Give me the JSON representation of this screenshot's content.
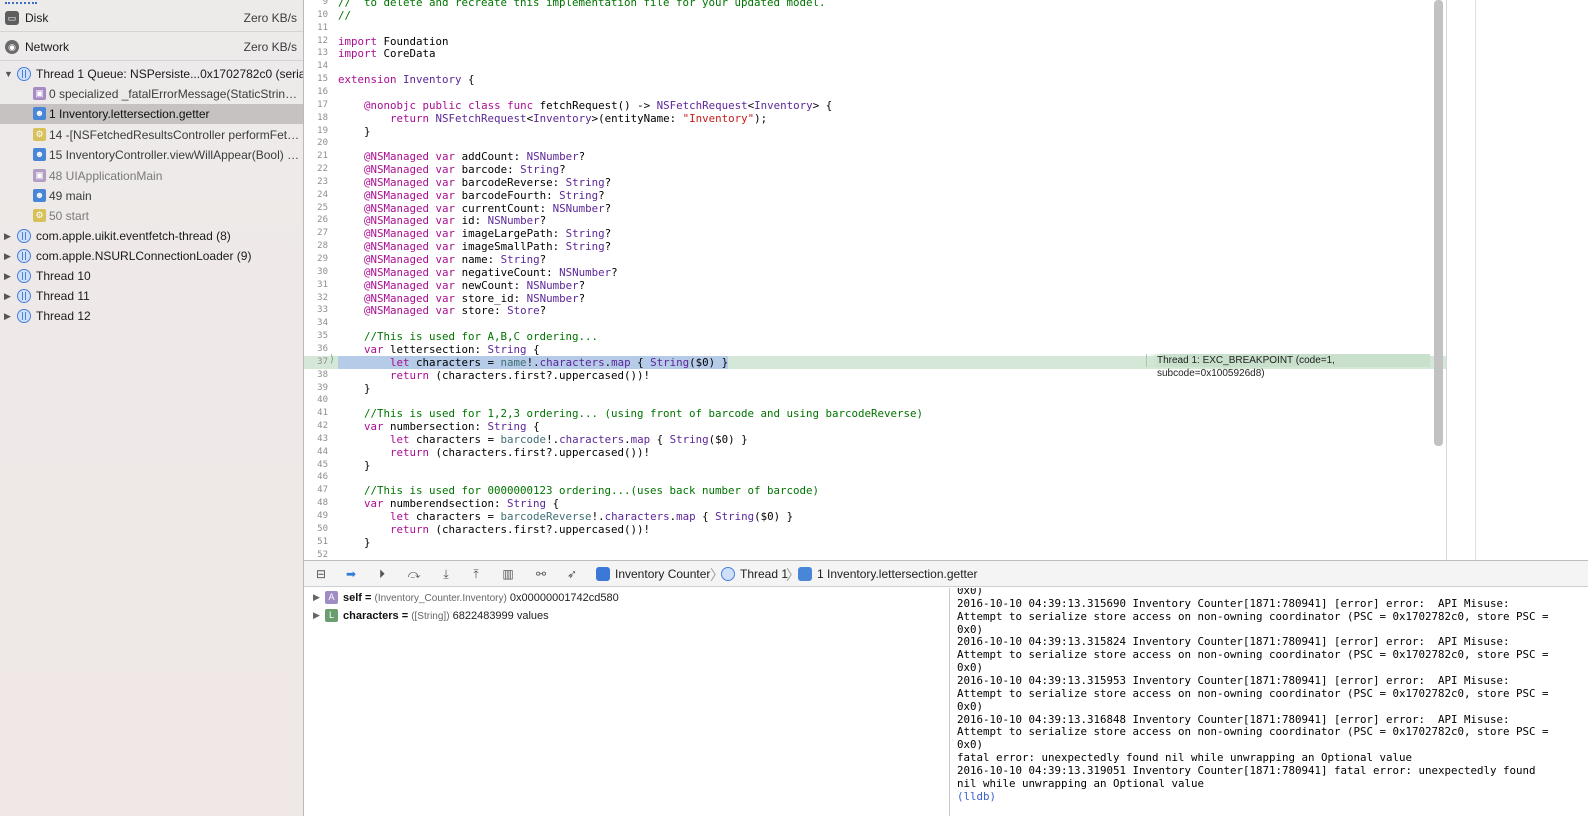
{
  "navigator": {
    "gauges": [
      {
        "label": "Disk",
        "value": "Zero KB/s",
        "icon": "disk-icon"
      },
      {
        "label": "Network",
        "value": "Zero KB/s",
        "icon": "network-icon"
      }
    ],
    "threads": [
      {
        "label": "Thread 1 Queue: NSPersiste...0x1702782c0 (serial)",
        "expanded": true
      },
      {
        "label": "com.apple.uikit.eventfetch-thread (8)",
        "expanded": false
      },
      {
        "label": "com.apple.NSURLConnectionLoader (9)",
        "expanded": false
      },
      {
        "label": "Thread 10",
        "expanded": false
      },
      {
        "label": "Thread 11",
        "expanded": false
      },
      {
        "label": "Thread 12",
        "expanded": false
      }
    ],
    "frames": [
      {
        "label": "0 specialized _fatalErrorMessage(StaticString,...",
        "icon": "system-frame-icon",
        "selected": false,
        "dim": false
      },
      {
        "label": "1 Inventory.lettersection.getter",
        "icon": "user-frame-icon",
        "selected": true,
        "dim": false
      },
      {
        "label": "14 -[NSFetchedResultsController performFetc...",
        "icon": "framework-frame-icon",
        "selected": false,
        "dim": false
      },
      {
        "label": "15 InventoryController.viewWillAppear(Bool) -...",
        "icon": "user-frame-icon",
        "selected": false,
        "dim": false
      },
      {
        "label": "48 UIApplicationMain",
        "icon": "system-frame-icon",
        "selected": false,
        "dim": true
      },
      {
        "label": "49 main",
        "icon": "user-frame-icon",
        "selected": false,
        "dim": false
      },
      {
        "label": "50 start",
        "icon": "framework-frame-icon",
        "selected": false,
        "dim": true
      }
    ]
  },
  "editor": {
    "lines": [
      {
        "n": "9",
        "t": "//  to delete and recreate this implementation file for your updated model."
      },
      {
        "n": "10",
        "t": "//"
      },
      {
        "n": "11",
        "t": ""
      },
      {
        "n": "12",
        "t": "import Foundation"
      },
      {
        "n": "13",
        "t": "import CoreData"
      },
      {
        "n": "14",
        "t": ""
      },
      {
        "n": "15",
        "t": "extension Inventory {"
      },
      {
        "n": "16",
        "t": ""
      },
      {
        "n": "17",
        "t": "    @nonobjc public class func fetchRequest() -> NSFetchRequest<Inventory> {"
      },
      {
        "n": "18",
        "t": "        return NSFetchRequest<Inventory>(entityName: \"Inventory\");"
      },
      {
        "n": "19",
        "t": "    }"
      },
      {
        "n": "20",
        "t": ""
      },
      {
        "n": "21",
        "t": "    @NSManaged var addCount: NSNumber?"
      },
      {
        "n": "22",
        "t": "    @NSManaged var barcode: String?"
      },
      {
        "n": "23",
        "t": "    @NSManaged var barcodeReverse: String?"
      },
      {
        "n": "24",
        "t": "    @NSManaged var barcodeFourth: String?"
      },
      {
        "n": "25",
        "t": "    @NSManaged var currentCount: NSNumber?"
      },
      {
        "n": "26",
        "t": "    @NSManaged var id: NSNumber?"
      },
      {
        "n": "27",
        "t": "    @NSManaged var imageLargePath: String?"
      },
      {
        "n": "28",
        "t": "    @NSManaged var imageSmallPath: String?"
      },
      {
        "n": "29",
        "t": "    @NSManaged var name: String?"
      },
      {
        "n": "30",
        "t": "    @NSManaged var negativeCount: NSNumber?"
      },
      {
        "n": "31",
        "t": "    @NSManaged var newCount: NSNumber?"
      },
      {
        "n": "32",
        "t": "    @NSManaged var store_id: NSNumber?"
      },
      {
        "n": "33",
        "t": "    @NSManaged var store: Store?"
      },
      {
        "n": "34",
        "t": ""
      },
      {
        "n": "35",
        "t": "    //This is used for A,B,C ordering..."
      },
      {
        "n": "36",
        "t": "    var lettersection: String {"
      },
      {
        "n": "37",
        "t": "        let characters = name!.characters.map { String($0) }"
      },
      {
        "n": "38",
        "t": "        return (characters.first?.uppercased())!"
      },
      {
        "n": "39",
        "t": "    }"
      },
      {
        "n": "40",
        "t": ""
      },
      {
        "n": "41",
        "t": "    //This is used for 1,2,3 ordering... (using front of barcode and using barcodeReverse)"
      },
      {
        "n": "42",
        "t": "    var numbersection: String {"
      },
      {
        "n": "43",
        "t": "        let characters = barcode!.characters.map { String($0) }"
      },
      {
        "n": "44",
        "t": "        return (characters.first?.uppercased())!"
      },
      {
        "n": "45",
        "t": "    }"
      },
      {
        "n": "46",
        "t": ""
      },
      {
        "n": "47",
        "t": "    //This is used for 0000000123 ordering...(uses back number of barcode)"
      },
      {
        "n": "48",
        "t": "    var numberendsection: String {"
      },
      {
        "n": "49",
        "t": "        let characters = barcodeReverse!.characters.map { String($0) }"
      },
      {
        "n": "50",
        "t": "        return (characters.first?.uppercased())!"
      },
      {
        "n": "51",
        "t": "    }"
      },
      {
        "n": "52",
        "t": ""
      }
    ],
    "highlighted_line": "37",
    "breakpoint_label": "Thread 1: EXC_BREAKPOINT (code=1, subcode=0x1005926d8)"
  },
  "debug_bar": {
    "breadcrumb": [
      {
        "label": "Inventory Counter",
        "icon": "app-icon"
      },
      {
        "label": "Thread 1",
        "icon": "thread-icon"
      },
      {
        "label": "1 Inventory.lettersection.getter",
        "icon": "user-frame-icon"
      }
    ]
  },
  "variables": [
    {
      "badge": "A",
      "name": "self",
      "type": "(Inventory_Counter.Inventory)",
      "value": "0x00000001742cd580"
    },
    {
      "badge": "L",
      "name": "characters",
      "type": "([String])",
      "value": "6822483999 values"
    }
  ],
  "console": {
    "lines": [
      "0x0)",
      "2016-10-10 04:39:13.315690 Inventory Counter[1871:780941] [error] error:  API Misuse:",
      "Attempt to serialize store access on non-owning coordinator (PSC = 0x1702782c0, store PSC =",
      "0x0)",
      "2016-10-10 04:39:13.315824 Inventory Counter[1871:780941] [error] error:  API Misuse:",
      "Attempt to serialize store access on non-owning coordinator (PSC = 0x1702782c0, store PSC =",
      "0x0)",
      "2016-10-10 04:39:13.315953 Inventory Counter[1871:780941] [error] error:  API Misuse:",
      "Attempt to serialize store access on non-owning coordinator (PSC = 0x1702782c0, store PSC =",
      "0x0)",
      "2016-10-10 04:39:13.316848 Inventory Counter[1871:780941] [error] error:  API Misuse:",
      "Attempt to serialize store access on non-owning coordinator (PSC = 0x1702782c0, store PSC =",
      "0x0)",
      "fatal error: unexpectedly found nil while unwrapping an Optional value",
      "2016-10-10 04:39:13.319051 Inventory Counter[1871:780941] fatal error: unexpectedly found",
      "nil while unwrapping an Optional value"
    ],
    "prompt": "(lldb)"
  }
}
